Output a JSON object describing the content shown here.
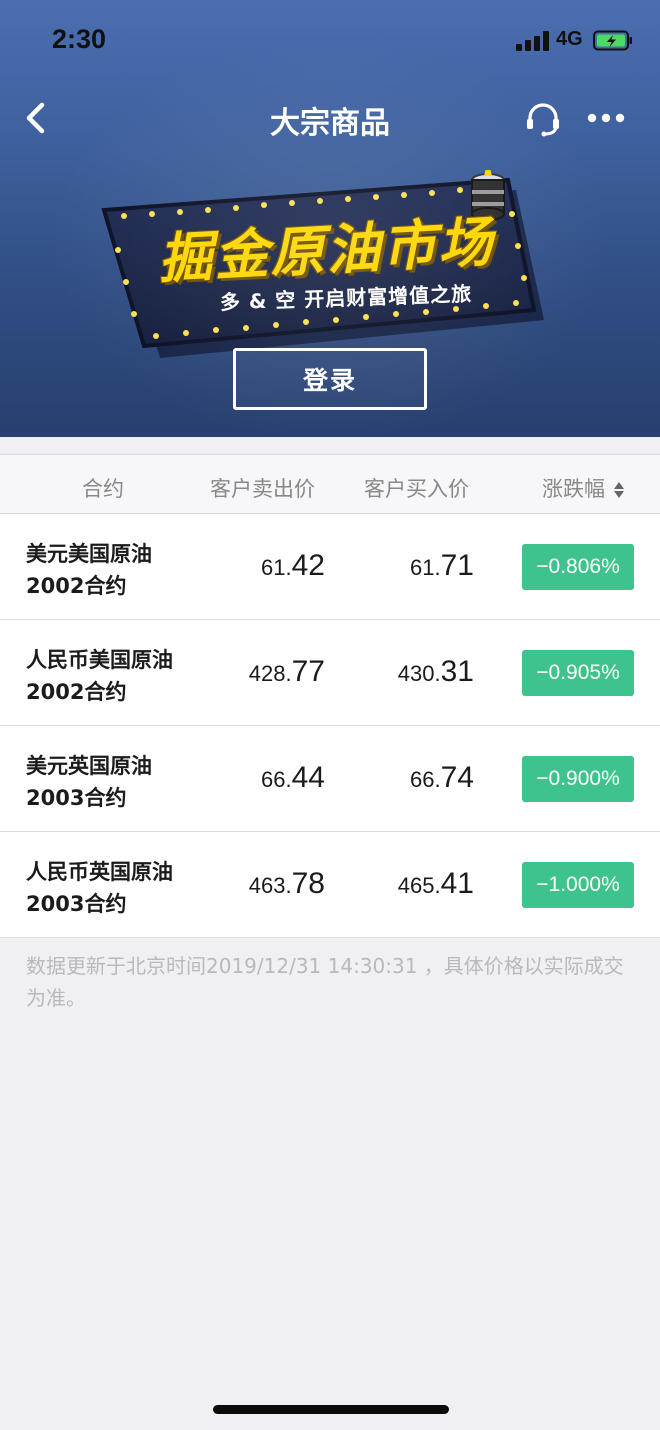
{
  "status_bar": {
    "time": "2:30",
    "network": "4G"
  },
  "nav": {
    "title": "大宗商品",
    "icons": [
      "chevron-left-icon",
      "headset-icon",
      "more-dots-icon"
    ]
  },
  "banner": {
    "title": "掘金原油市场",
    "subtitle": "多 & 空  开启财富增值之旅",
    "login_label": "登录"
  },
  "table": {
    "headers": {
      "contract": "合约",
      "sell": "客户卖出价",
      "buy": "客户买入价",
      "change": "涨跌幅"
    },
    "rows": [
      {
        "name_line1": "美元美国原油",
        "name_line2": "2002合约",
        "sell_small": "61.",
        "sell_big": "42",
        "buy_small": "61.",
        "buy_big": "71",
        "change": "−0.806%"
      },
      {
        "name_line1": "人民币美国原油",
        "name_line2": "2002合约",
        "sell_small": "428.",
        "sell_big": "77",
        "buy_small": "430.",
        "buy_big": "31",
        "change": "−0.905%"
      },
      {
        "name_line1": "美元英国原油",
        "name_line2": "2003合约",
        "sell_small": "66.",
        "sell_big": "44",
        "buy_small": "66.",
        "buy_big": "74",
        "change": "−0.900%"
      },
      {
        "name_line1": "人民币英国原油",
        "name_line2": "2003合约",
        "sell_small": "463.",
        "sell_big": "78",
        "buy_small": "465.",
        "buy_big": "41",
        "change": "−1.000%"
      }
    ]
  },
  "footnote": "数据更新于北京时间2019/12/31 14:30:31 ，具体价格以实际成交为准。",
  "colors": {
    "header_bg": "#3d5f9c",
    "change_badge": "#3ec38c",
    "banner_yellow": "#ffd600"
  }
}
